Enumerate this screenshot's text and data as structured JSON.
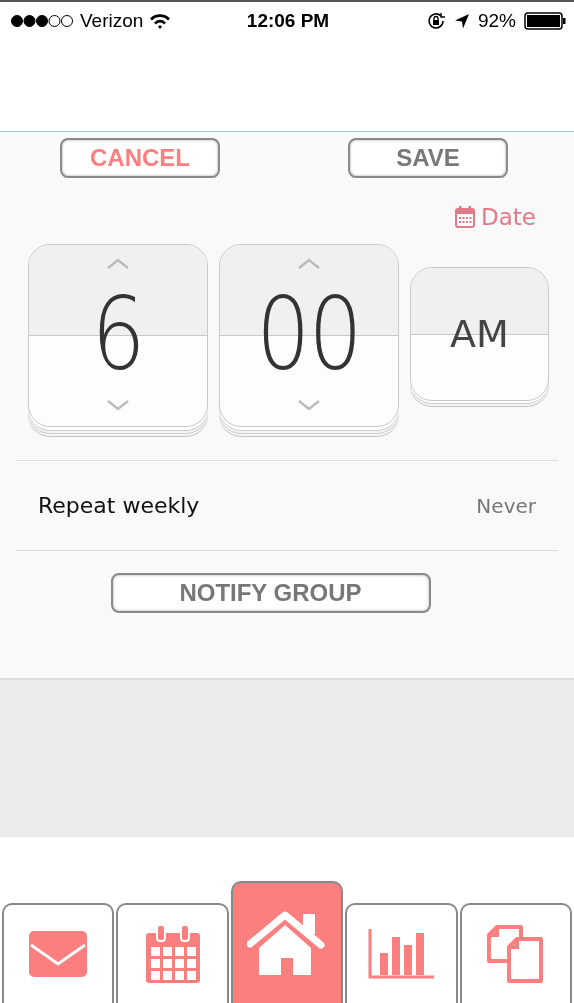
{
  "status_bar": {
    "carrier": "Verizon",
    "time": "12:06 PM",
    "battery": "92%"
  },
  "actions": {
    "cancel": "CANCEL",
    "save": "SAVE"
  },
  "date_link": "Date",
  "pickers": [
    {
      "kind": "spinner",
      "value": "6"
    },
    {
      "kind": "spinner",
      "value": "00"
    },
    {
      "kind": "toggle",
      "value": "AM"
    }
  ],
  "repeat": {
    "label": "Repeat weekly",
    "value": "Never"
  },
  "notify_button": "NOTIFY GROUP",
  "tabs": [
    {
      "kind": "mail",
      "selected": false
    },
    {
      "kind": "calendar",
      "selected": false
    },
    {
      "kind": "home",
      "selected": true
    },
    {
      "kind": "chart",
      "selected": false
    },
    {
      "kind": "copy",
      "selected": false
    }
  ]
}
